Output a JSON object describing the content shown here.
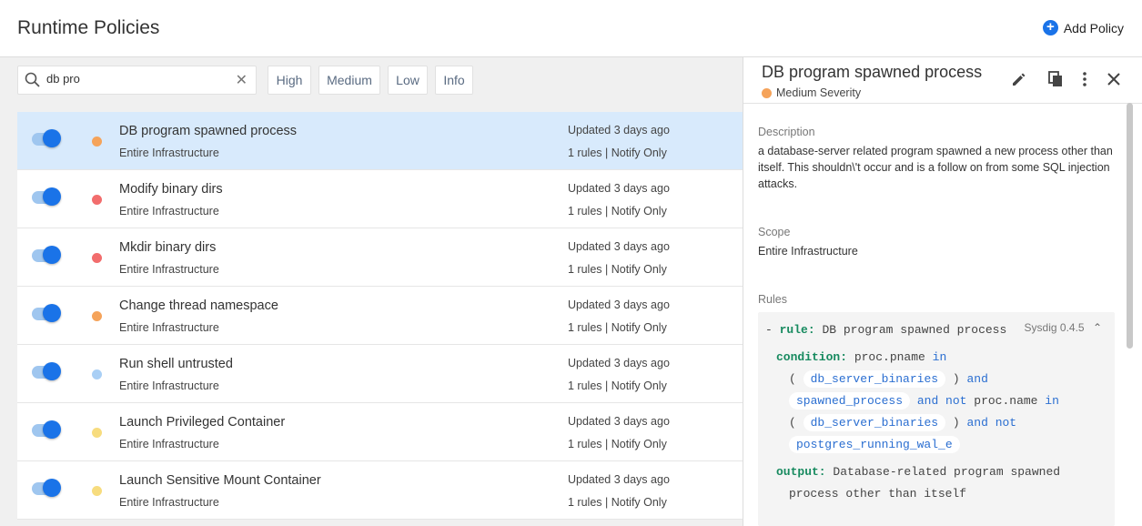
{
  "header": {
    "title": "Runtime Policies",
    "add_label": "Add Policy"
  },
  "search": {
    "value": "db pro",
    "placeholder": ""
  },
  "filters": [
    "High",
    "Medium",
    "Low",
    "Info"
  ],
  "colors": {
    "high": "#f26d6d",
    "medium": "#f5a35a",
    "low": "#a9cff5",
    "info": "#f7dc7e",
    "accent": "#1a73e8"
  },
  "policies": [
    {
      "name": "DB program spawned process",
      "scope": "Entire Infrastructure",
      "updated": "Updated 3 days ago",
      "meta": "1 rules | Notify Only",
      "severity": "medium",
      "enabled": true,
      "selected": true
    },
    {
      "name": "Modify binary dirs",
      "scope": "Entire Infrastructure",
      "updated": "Updated 3 days ago",
      "meta": "1 rules | Notify Only",
      "severity": "high",
      "enabled": true
    },
    {
      "name": "Mkdir binary dirs",
      "scope": "Entire Infrastructure",
      "updated": "Updated 3 days ago",
      "meta": "1 rules | Notify Only",
      "severity": "high",
      "enabled": true
    },
    {
      "name": "Change thread namespace",
      "scope": "Entire Infrastructure",
      "updated": "Updated 3 days ago",
      "meta": "1 rules | Notify Only",
      "severity": "medium",
      "enabled": true
    },
    {
      "name": "Run shell untrusted",
      "scope": "Entire Infrastructure",
      "updated": "Updated 3 days ago",
      "meta": "1 rules | Notify Only",
      "severity": "low",
      "enabled": true
    },
    {
      "name": "Launch Privileged Container",
      "scope": "Entire Infrastructure",
      "updated": "Updated 3 days ago",
      "meta": "1 rules | Notify Only",
      "severity": "info",
      "enabled": true
    },
    {
      "name": "Launch Sensitive Mount Container",
      "scope": "Entire Infrastructure",
      "updated": "Updated 3 days ago",
      "meta": "1 rules | Notify Only",
      "severity": "info",
      "enabled": true
    }
  ],
  "panel": {
    "title": "DB program spawned process",
    "severity": "Medium Severity",
    "description_label": "Description",
    "description": "a database-server related program spawned a new process other than itself. This shouldn\\'t occur and is a follow on from some SQL injection attacks.",
    "scope_label": "Scope",
    "scope": "Entire Infrastructure",
    "rules_label": "Rules",
    "rule": {
      "dash": "-",
      "rule_key": "rule:",
      "rule_name": "DB program spawned process",
      "version": "Sysdig 0.4.5",
      "condition_key": "condition:",
      "c_proc_pname": "proc.pname",
      "c_in": "in",
      "c_paren_open": "(",
      "c_paren_close": ")",
      "c_and": "and",
      "c_and_not": "and not",
      "c_proc_name": "proc.name",
      "macro_db_server_binaries": "db_server_binaries",
      "macro_spawned_process": "spawned_process",
      "macro_postgres": "postgres_running_wal_e",
      "output_key": "output:",
      "output_line1": "Database-related program spawned",
      "output_line2": "process other than itself"
    }
  }
}
